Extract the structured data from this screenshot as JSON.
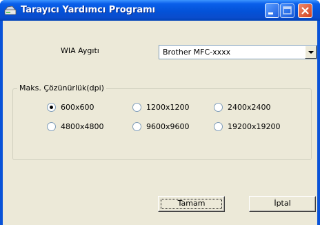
{
  "window": {
    "title": "Tarayıcı Yardımcı Programı",
    "icon": "scanner-icon",
    "controls": [
      "minimize-icon",
      "maximize-icon",
      "close-icon"
    ]
  },
  "device": {
    "label": "WIA Aygıtı",
    "selected": "Brother MFC-xxxx"
  },
  "resolution": {
    "legend": "Maks. Çözünürlük(dpi)",
    "options": [
      "600x600",
      "1200x1200",
      "2400x2400",
      "4800x4800",
      "9600x9600",
      "19200x19200"
    ],
    "selected": "600x600"
  },
  "buttons": {
    "ok": "Tamam",
    "cancel": "İptal"
  },
  "colors": {
    "titlebar": "#0352d8",
    "client": "#ece9d8",
    "close": "#d2401e"
  }
}
